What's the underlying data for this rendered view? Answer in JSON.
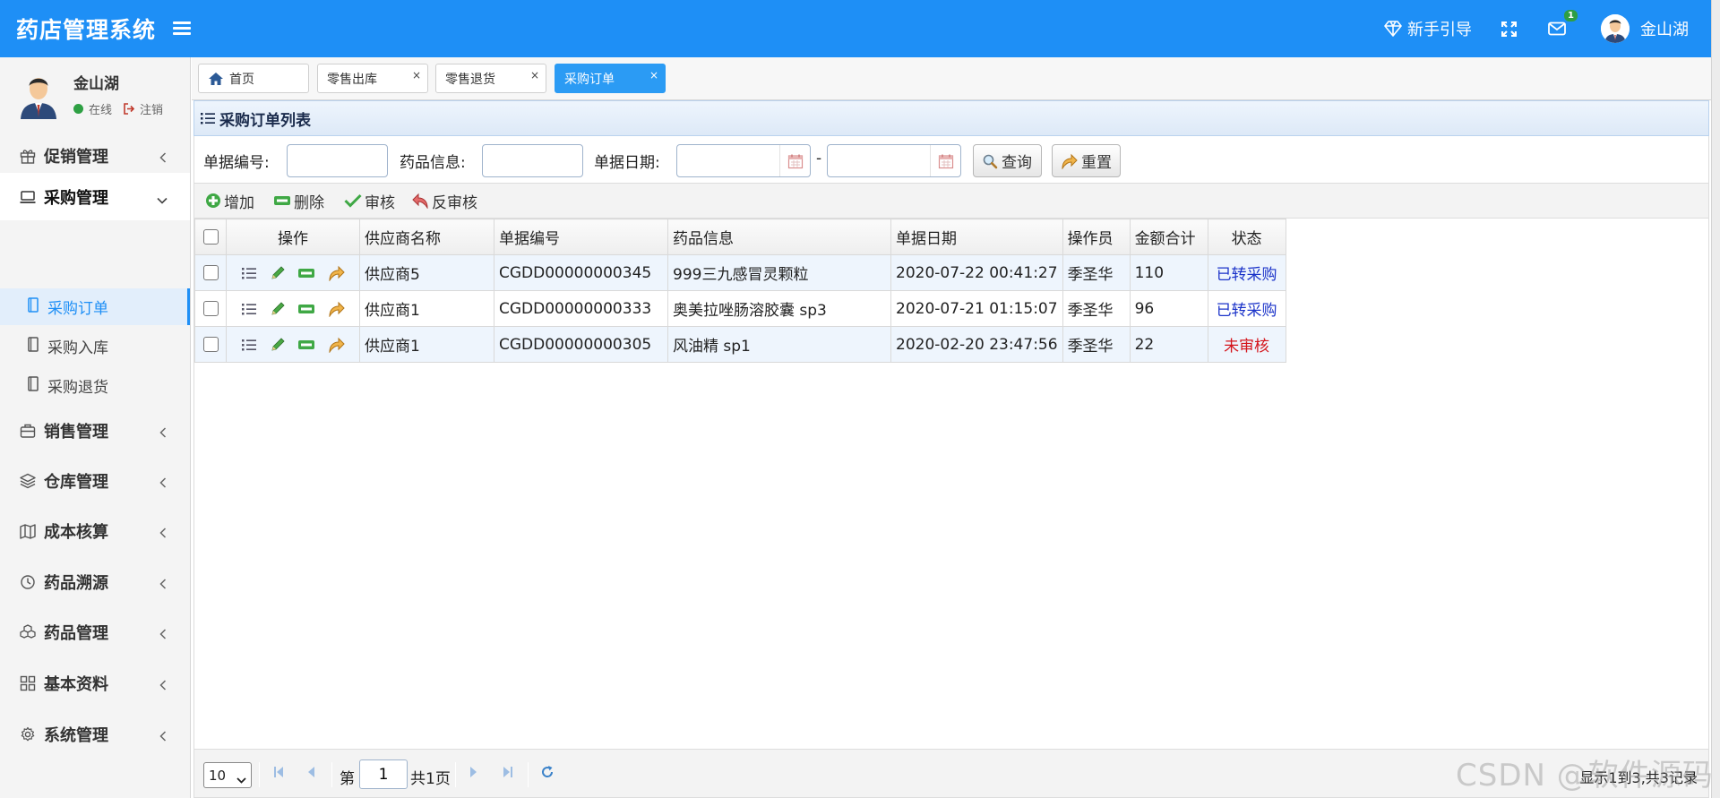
{
  "app": {
    "title": "药店管理系统"
  },
  "header": {
    "guide_label": "新手引导",
    "mail_badge": "1",
    "user_name": "金山湖"
  },
  "sidebar": {
    "user": {
      "name": "金山湖",
      "status": "在线",
      "logout": "注销"
    },
    "menu": [
      {
        "label": "促销管理",
        "icon": "gift-icon"
      },
      {
        "label": "采购管理",
        "icon": "laptop-icon",
        "open": true
      },
      {
        "label": "销售管理",
        "icon": "briefcase-icon"
      },
      {
        "label": "仓库管理",
        "icon": "layers-icon"
      },
      {
        "label": "成本核算",
        "icon": "map-icon"
      },
      {
        "label": "药品溯源",
        "icon": "history-icon"
      },
      {
        "label": "药品管理",
        "icon": "cubes-icon"
      },
      {
        "label": "基本资料",
        "icon": "grid-icon"
      },
      {
        "label": "系统管理",
        "icon": "gear-icon"
      }
    ],
    "submenu": [
      {
        "label": "采购订单",
        "icon": "book-icon",
        "active": true
      },
      {
        "label": "采购入库",
        "icon": "book-icon"
      },
      {
        "label": "采购退货",
        "icon": "book-icon"
      }
    ]
  },
  "tabs": [
    {
      "label": "首页",
      "icon": "home-icon",
      "closable": false
    },
    {
      "label": "零售出库",
      "closable": true
    },
    {
      "label": "零售退货",
      "closable": true
    },
    {
      "label": "采购订单",
      "closable": true,
      "active": true
    }
  ],
  "panel": {
    "title": "采购订单列表",
    "search": {
      "doc_no_label": "单据编号:",
      "doc_no_value": "",
      "drug_label": "药品信息:",
      "drug_value": "",
      "date_label": "单据日期:",
      "date_from": "",
      "date_to": "",
      "date_sep": "-",
      "query_label": "查询",
      "reset_label": "重置"
    },
    "toolbar": {
      "add": "增加",
      "delete": "删除",
      "audit": "审核",
      "unaudit": "反审核"
    },
    "table": {
      "columns": [
        "操作",
        "供应商名称",
        "单据编号",
        "药品信息",
        "单据日期",
        "操作员",
        "金额合计",
        "状态"
      ],
      "rows": [
        {
          "supplier": "供应商5",
          "doc_no": "CGDD00000000345",
          "drug": "999三九感冒灵颗粒",
          "date": "2020-07-22 00:41:27",
          "operator": "季圣华",
          "amount": "110",
          "status": "已转采购",
          "status_color": "#1b33c9"
        },
        {
          "supplier": "供应商1",
          "doc_no": "CGDD00000000333",
          "drug": "奥美拉唑肠溶胶囊 sp3",
          "date": "2020-07-21 01:15:07",
          "operator": "季圣华",
          "amount": "96",
          "status": "已转采购",
          "status_color": "#1b33c9"
        },
        {
          "supplier": "供应商1",
          "doc_no": "CGDD00000000305",
          "drug": "风油精 sp1",
          "date": "2020-02-20 23:47:56",
          "operator": "季圣华",
          "amount": "22",
          "status": "未审核",
          "status_color": "#d4141b"
        }
      ]
    },
    "pager": {
      "page_size": "10",
      "page_prefix": "第",
      "page_value": "1",
      "page_suffix": "共1页",
      "info": "显示1到3,共3记录"
    }
  },
  "watermark": "CSDN @软件源码",
  "colors": {
    "brand": "#1e8ff6",
    "active_tab": "#2b9bf4",
    "status_done": "#1b33c9",
    "status_pending": "#d4141b"
  }
}
